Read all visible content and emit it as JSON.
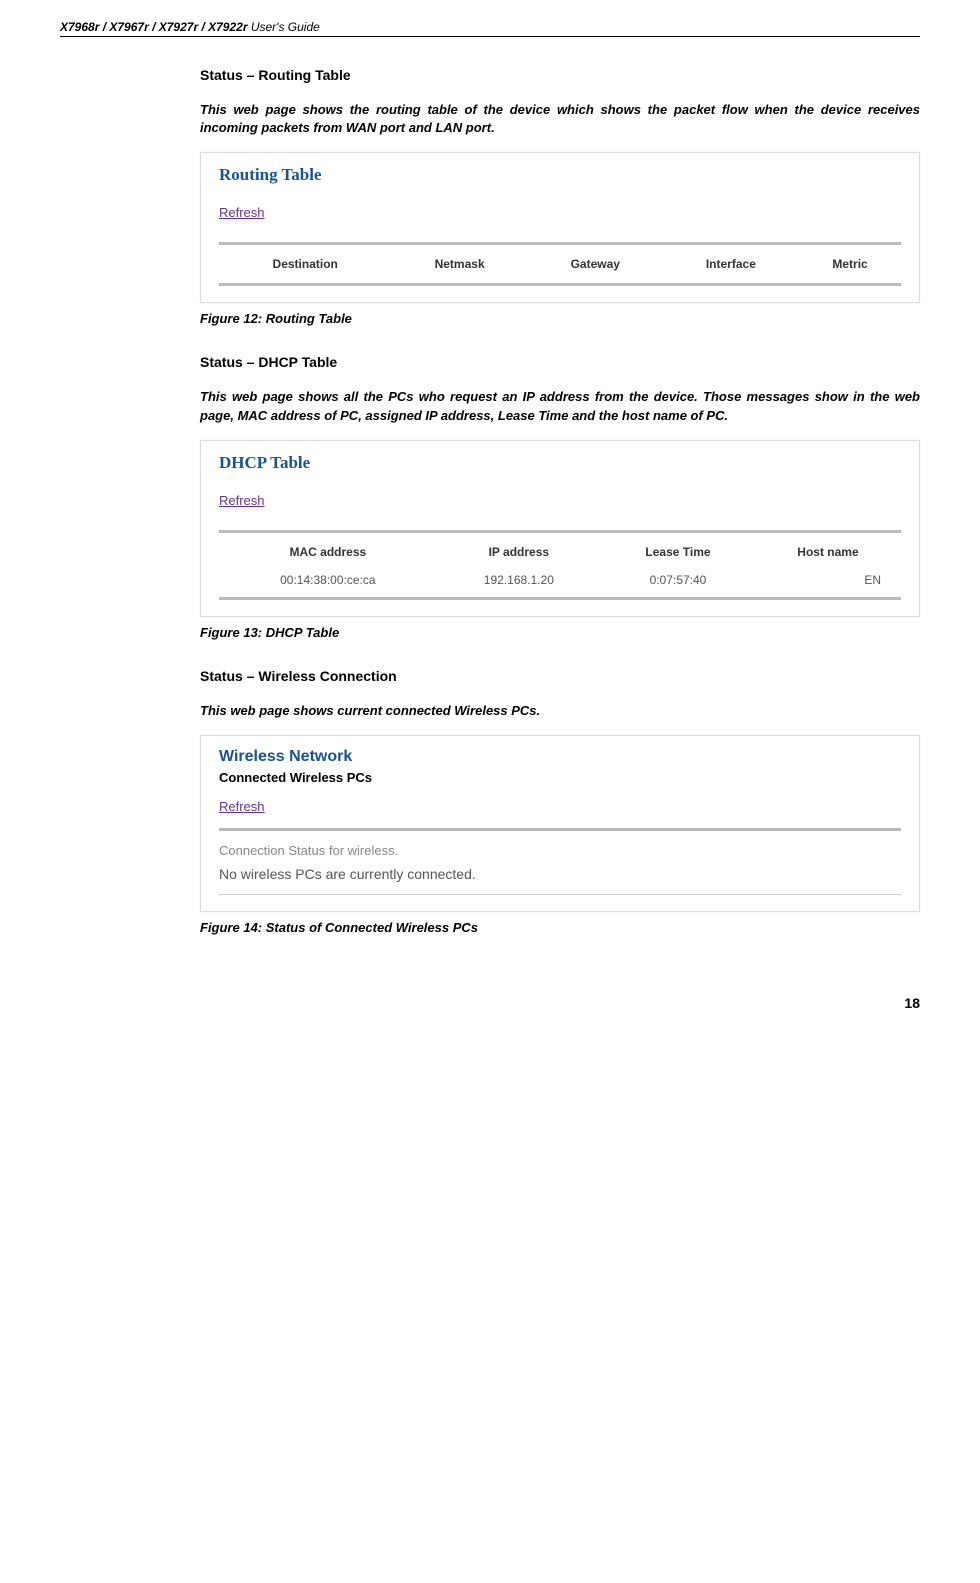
{
  "header": {
    "product": "X7968r / X7967r / X7927r / X7922r",
    "suffix": " User's Guide"
  },
  "section1": {
    "title": "Status – Routing Table",
    "desc": "This web page shows the routing table of the device which shows the packet flow when the device receives incoming packets from WAN port and LAN port.",
    "panel_title": "Routing Table",
    "refresh": "Refresh",
    "columns": {
      "c1": "Destination",
      "c2": "Netmask",
      "c3": "Gateway",
      "c4": "Interface",
      "c5": "Metric"
    },
    "caption": "Figure 12: Routing Table"
  },
  "section2": {
    "title": "Status – DHCP Table",
    "desc": "This web page shows all the PCs who request an IP address from the device. Those messages show in the web page, MAC address of PC, assigned IP address, Lease Time and the host name of PC.",
    "panel_title": "DHCP Table",
    "refresh": "Refresh",
    "columns": {
      "c1": "MAC address",
      "c2": "IP address",
      "c3": "Lease Time",
      "c4": "Host name"
    },
    "row": {
      "mac": "00:14:38:00:ce:ca",
      "ip": "192.168.1.20",
      "lease": "0:07:57:40",
      "host": "EN"
    },
    "caption": "Figure 13: DHCP Table"
  },
  "section3": {
    "title": "Status – Wireless Connection",
    "desc": "This web page shows current connected Wireless PCs.",
    "panel_title": "Wireless Network",
    "panel_subtitle": "Connected Wireless PCs",
    "refresh": "Refresh",
    "conn_status": "Connection Status for wireless.",
    "conn_msg": "No wireless PCs are currently connected.",
    "caption": "Figure 14: Status of Connected Wireless PCs"
  },
  "page_number": "18"
}
